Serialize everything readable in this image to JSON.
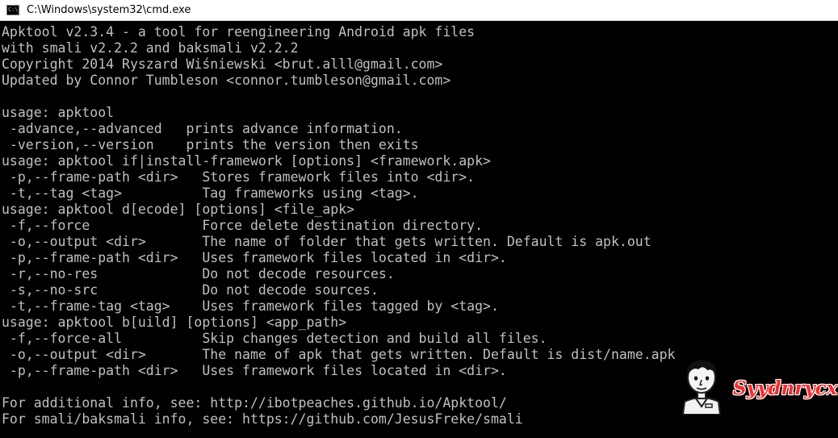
{
  "window": {
    "title": "C:\\Windows\\system32\\cmd.exe",
    "icon": "cmd-icon",
    "icon_glyph": "C:\\"
  },
  "console": {
    "lines": [
      "Apktool v2.3.4 - a tool for reengineering Android apk files",
      "with smali v2.2.2 and baksmali v2.2.2",
      "Copyright 2014 Ryszard Wiśniewski <brut.alll@gmail.com>",
      "Updated by Connor Tumbleson <connor.tumbleson@gmail.com>",
      "",
      "usage: apktool",
      " -advance,--advanced   prints advance information.",
      " -version,--version    prints the version then exits",
      "usage: apktool if|install-framework [options] <framework.apk>",
      " -p,--frame-path <dir>   Stores framework files into <dir>.",
      " -t,--tag <tag>          Tag frameworks using <tag>.",
      "usage: apktool d[ecode] [options] <file_apk>",
      " -f,--force              Force delete destination directory.",
      " -o,--output <dir>       The name of folder that gets written. Default is apk.out",
      " -p,--frame-path <dir>   Uses framework files located in <dir>.",
      " -r,--no-res             Do not decode resources.",
      " -s,--no-src             Do not decode sources.",
      " -t,--frame-tag <tag>    Uses framework files tagged by <tag>.",
      "usage: apktool b[uild] [options] <app_path>",
      " -f,--force-all          Skip changes detection and build all files.",
      " -o,--output <dir>       The name of apk that gets written. Default is dist/name.apk",
      " -p,--frame-path <dir>   Uses framework files located in <dir>.",
      "",
      "For additional info, see: http://ibotpeaches.github.io/Apktool/",
      "For smali/baksmali info, see: https://github.com/JesusFreke/smali"
    ]
  },
  "watermark": {
    "text": "Syydnrycx",
    "color": "#ff2a2a",
    "avatar_icon": "cartoon-avatar-icon"
  },
  "colors": {
    "console_bg": "#000000",
    "console_fg": "#c0c0c0",
    "titlebar_bg": "#ffffff"
  }
}
